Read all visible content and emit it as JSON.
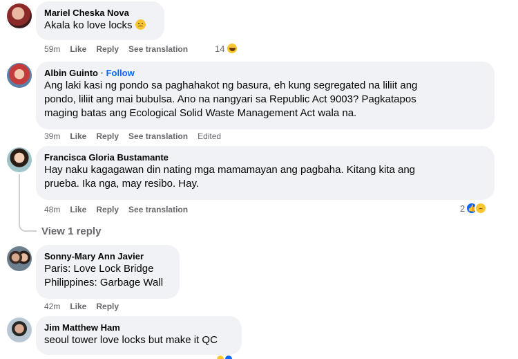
{
  "comments": [
    {
      "author": "Mariel Cheska Nova",
      "text": [
        "Akala ko love locks"
      ],
      "time": "59m",
      "like": "Like",
      "reply": "Reply",
      "see_translation": "See translation",
      "reaction_count": "14",
      "reaction_icons": [
        "haha-icon"
      ]
    },
    {
      "author": "Albin Guinto",
      "follow": "Follow",
      "text": [
        "Ang laki kasi ng pondo sa paghahakot ng basura, eh kung segregated na liliit ang",
        "pondo, liliit ang mai bubulsa. Ano na nangyari sa Republic Act 9003? Pagkatapos",
        "maging batas ang Ecological Solid Waste Management Act wala na."
      ],
      "time": "39m",
      "like": "Like",
      "reply": "Reply",
      "see_translation": "See translation",
      "edited": "Edited"
    },
    {
      "author": "Francisca Gloria Bustamante",
      "text": [
        "Hay naku kagagawan din nating mga mamamayan ang pagbaha. Kitang kita ang",
        "prueba. Ika nga, may resibo. Hay."
      ],
      "time": "48m",
      "like": "Like",
      "reply": "Reply",
      "see_translation": "See translation",
      "reaction_count": "2",
      "reaction_icons": [
        "like-icon",
        "sad-icon"
      ],
      "view_replies": "View 1 reply"
    },
    {
      "author": "Sonny-Mary Ann Javier",
      "text": [
        "Paris: Love Lock Bridge",
        "Philippines: Garbage Wall"
      ],
      "time": "42m",
      "like": "Like",
      "reply": "Reply"
    },
    {
      "author": "Jim Matthew Ham",
      "text": [
        "seoul tower love locks but make it QC"
      ]
    }
  ],
  "colors": {
    "bubble_bg": "#f0f2f5",
    "secondary_text": "#65676b",
    "follow_link": "#0866ff"
  }
}
